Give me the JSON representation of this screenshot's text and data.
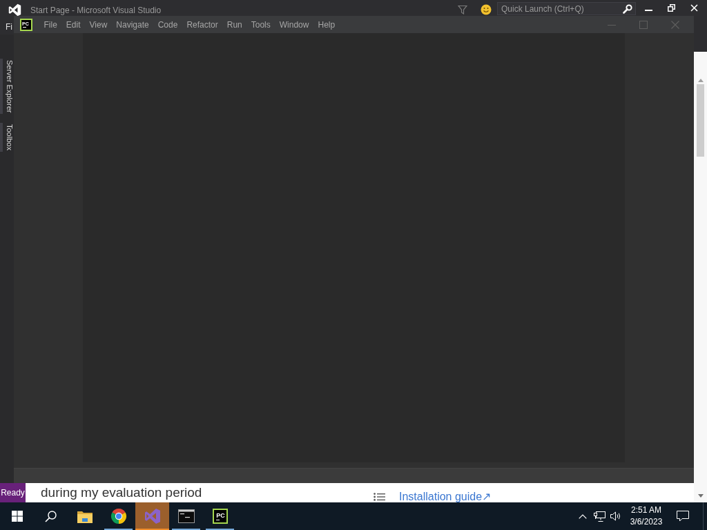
{
  "vs_window": {
    "title": "Start Page - Microsoft Visual Studio",
    "quick_launch": {
      "placeholder": "Quick Launch (Ctrl+Q)"
    },
    "menu": [
      {
        "label": "Fi"
      }
    ],
    "side_tabs": [
      {
        "label": "Server Explorer"
      },
      {
        "label": "Toolbox"
      }
    ],
    "status_bar": {
      "text": "Ready"
    }
  },
  "ide_window": {
    "logo_text": "PC",
    "menu": [
      {
        "label": "File"
      },
      {
        "label": "Edit"
      },
      {
        "label": "View"
      },
      {
        "label": "Navigate"
      },
      {
        "label": "Code"
      },
      {
        "label": "Refactor"
      },
      {
        "label": "Run"
      },
      {
        "label": "Tools"
      },
      {
        "label": "Window"
      },
      {
        "label": "Help"
      }
    ]
  },
  "web_page": {
    "text": "during my evaluation period",
    "link": "Installation guide↗"
  },
  "taskbar": {
    "apps": [
      {
        "kind": "start",
        "running": false,
        "active": false
      },
      {
        "kind": "search",
        "running": false,
        "active": false
      },
      {
        "kind": "explorer",
        "running": false,
        "active": false
      },
      {
        "kind": "browser",
        "running": true,
        "active": false
      },
      {
        "kind": "visual-studio",
        "running": true,
        "active": true
      },
      {
        "kind": "terminal",
        "running": true,
        "active": false
      },
      {
        "kind": "pc-ide",
        "label": "PC",
        "running": true,
        "active": false
      }
    ],
    "clock": {
      "time": "2:51 AM",
      "date": "3/6/2023"
    }
  }
}
